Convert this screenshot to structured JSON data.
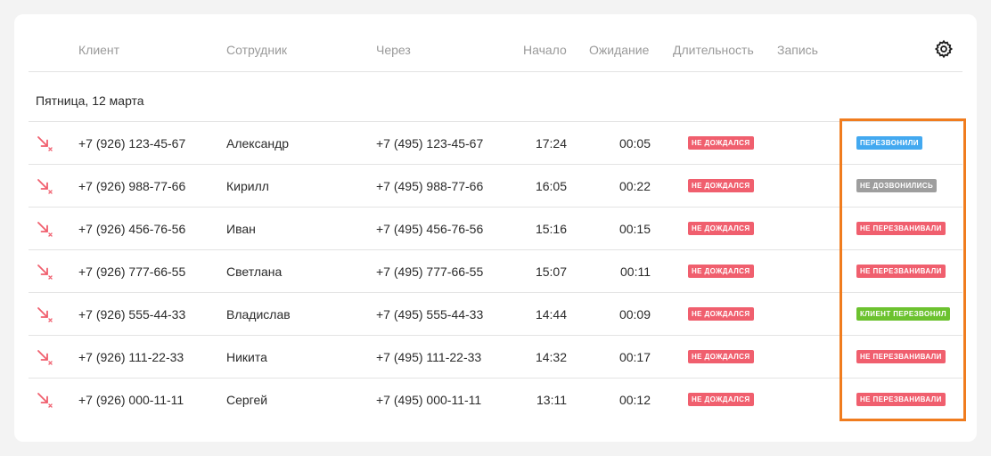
{
  "colors": {
    "missed": "#f05f6e",
    "blue": "#43a9f0",
    "gray": "#9e9e9e",
    "red": "#f05f6e",
    "green": "#6cc22f",
    "highlight": "#f07c1e"
  },
  "table": {
    "headers": {
      "client": "Клиент",
      "employee": "Сотрудник",
      "via": "Через",
      "start": "Начало",
      "wait": "Ожидание",
      "duration": "Длительность",
      "record": "Запись"
    },
    "settings_icon": "gear-icon",
    "date_group": "Пятница, 12 марта",
    "rows": [
      {
        "icon": "missed-call-icon",
        "client": "+7 (926) 123-45-67",
        "employee": "Александр",
        "via": "+7 (495) 123-45-67",
        "start": "17:24",
        "wait": "00:05",
        "call_status": "НЕ ДОЖДАЛСЯ",
        "callback_status": "ПЕРЕЗВОНИЛИ",
        "callback_color": "blue"
      },
      {
        "icon": "missed-call-icon",
        "client": "+7 (926) 988-77-66",
        "employee": "Кирилл",
        "via": "+7 (495) 988-77-66",
        "start": "16:05",
        "wait": "00:22",
        "call_status": "НЕ ДОЖДАЛСЯ",
        "callback_status": "НЕ ДОЗВОНИЛИСЬ",
        "callback_color": "gray"
      },
      {
        "icon": "missed-call-icon",
        "client": "+7 (926) 456-76-56",
        "employee": "Иван",
        "via": "+7 (495) 456-76-56",
        "start": "15:16",
        "wait": "00:15",
        "call_status": "НЕ ДОЖДАЛСЯ",
        "callback_status": "НЕ ПЕРЕЗВАНИВАЛИ",
        "callback_color": "red"
      },
      {
        "icon": "missed-call-icon",
        "client": "+7 (926) 777-66-55",
        "employee": "Светлана",
        "via": "+7 (495) 777-66-55",
        "start": "15:07",
        "wait": "00:11",
        "call_status": "НЕ ДОЖДАЛСЯ",
        "callback_status": "НЕ ПЕРЕЗВАНИВАЛИ",
        "callback_color": "red"
      },
      {
        "icon": "missed-call-icon",
        "client": "+7 (926) 555-44-33",
        "employee": "Владислав",
        "via": "+7 (495) 555-44-33",
        "start": "14:44",
        "wait": "00:09",
        "call_status": "НЕ ДОЖДАЛСЯ",
        "callback_status": "КЛИЕНТ ПЕРЕЗВОНИЛ",
        "callback_color": "green"
      },
      {
        "icon": "missed-call-icon",
        "client": "+7 (926) 111-22-33",
        "employee": "Никита",
        "via": "+7 (495) 111-22-33",
        "start": "14:32",
        "wait": "00:17",
        "call_status": "НЕ ДОЖДАЛСЯ",
        "callback_status": "НЕ ПЕРЕЗВАНИВАЛИ",
        "callback_color": "red"
      },
      {
        "icon": "missed-call-icon",
        "client": "+7 (926) 000-11-11",
        "employee": "Сергей",
        "via": "+7 (495) 000-11-11",
        "start": "13:11",
        "wait": "00:12",
        "call_status": "НЕ ДОЖДАЛСЯ",
        "callback_status": "НЕ ПЕРЕЗВАНИВАЛИ",
        "callback_color": "red"
      }
    ]
  }
}
